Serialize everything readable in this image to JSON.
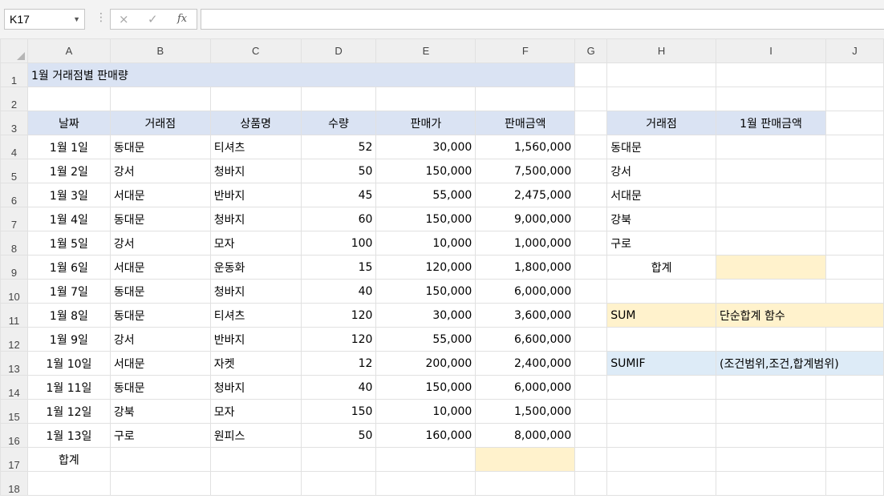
{
  "formula_bar": {
    "name_box": "K17",
    "cancel_icon": "×",
    "enter_icon": "✓",
    "fx_label": "fx",
    "formula": ""
  },
  "columns": [
    "A",
    "B",
    "C",
    "D",
    "E",
    "F",
    "G",
    "H",
    "I",
    "J"
  ],
  "rows": [
    "1",
    "2",
    "3",
    "4",
    "5",
    "6",
    "7",
    "8",
    "9",
    "10",
    "11",
    "12",
    "13",
    "14",
    "15",
    "16",
    "17",
    "18"
  ],
  "sheet": {
    "title": "1월 거래점별 판매량",
    "headers": [
      "날짜",
      "거래점",
      "상품명",
      "수량",
      "판매가",
      "판매금액"
    ],
    "data": [
      [
        "1월 1일",
        "동대문",
        "티셔츠",
        "52",
        "30,000",
        "1,560,000"
      ],
      [
        "1월 2일",
        "강서",
        "청바지",
        "50",
        "150,000",
        "7,500,000"
      ],
      [
        "1월 3일",
        "서대문",
        "반바지",
        "45",
        "55,000",
        "2,475,000"
      ],
      [
        "1월 4일",
        "동대문",
        "청바지",
        "60",
        "150,000",
        "9,000,000"
      ],
      [
        "1월 5일",
        "강서",
        "모자",
        "100",
        "10,000",
        "1,000,000"
      ],
      [
        "1월 6일",
        "서대문",
        "운동화",
        "15",
        "120,000",
        "1,800,000"
      ],
      [
        "1월 7일",
        "동대문",
        "청바지",
        "40",
        "150,000",
        "6,000,000"
      ],
      [
        "1월 8일",
        "동대문",
        "티셔츠",
        "120",
        "30,000",
        "3,600,000"
      ],
      [
        "1월 9일",
        "강서",
        "반바지",
        "120",
        "55,000",
        "6,600,000"
      ],
      [
        "1월 10일",
        "서대문",
        "자켓",
        "12",
        "200,000",
        "2,400,000"
      ],
      [
        "1월 11일",
        "동대문",
        "청바지",
        "40",
        "150,000",
        "6,000,000"
      ],
      [
        "1월 12일",
        "강북",
        "모자",
        "150",
        "10,000",
        "1,500,000"
      ],
      [
        "1월 13일",
        "구로",
        "원피스",
        "50",
        "160,000",
        "8,000,000"
      ]
    ],
    "total_label": "합계"
  },
  "summary": {
    "headers": [
      "거래점",
      "1월 판매금액"
    ],
    "stores": [
      "동대문",
      "강서",
      "서대문",
      "강북",
      "구로"
    ],
    "total_label": "합계"
  },
  "notes": {
    "sum_name": "SUM",
    "sum_desc": "단순합계 함수",
    "sumif_name": "SUMIF",
    "sumif_desc": "(조건범위,조건,합계범위)"
  },
  "colors": {
    "header_fill": "#dae3f3",
    "highlight_yellow": "#fff2cc",
    "highlight_blue": "#ddebf7",
    "active_cell_border": "#217346"
  }
}
